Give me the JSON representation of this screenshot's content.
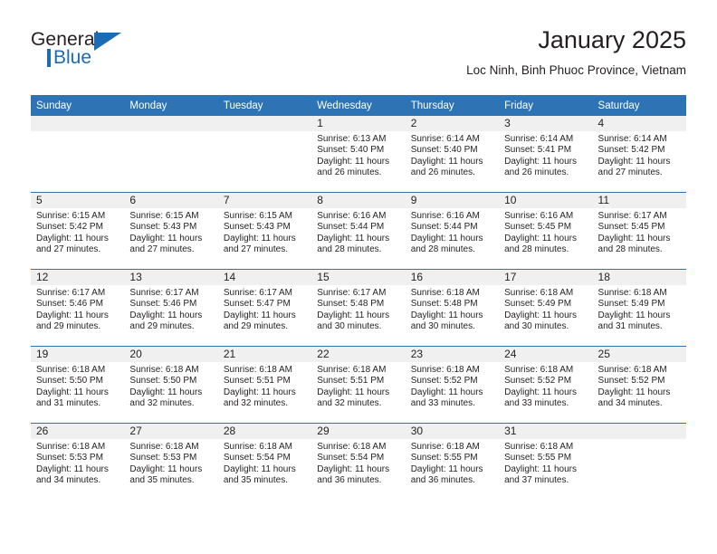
{
  "brand": {
    "name_part1": "General",
    "name_part2": "Blue",
    "logo_icon": "triangle-logo-icon"
  },
  "header": {
    "title": "January 2025",
    "subtitle": "Loc Ninh, Binh Phuoc Province, Vietnam"
  },
  "colors": {
    "header_blue": "#2e74b5",
    "brand_blue": "#1b6bb5",
    "daynum_band": "#f0f0f0",
    "text": "#231f20"
  },
  "calendar": {
    "weekdays": [
      "Sunday",
      "Monday",
      "Tuesday",
      "Wednesday",
      "Thursday",
      "Friday",
      "Saturday"
    ],
    "weeks": [
      [
        {
          "day": "",
          "sunrise": "",
          "sunset": "",
          "daylight_line1": "",
          "daylight_line2": ""
        },
        {
          "day": "",
          "sunrise": "",
          "sunset": "",
          "daylight_line1": "",
          "daylight_line2": ""
        },
        {
          "day": "",
          "sunrise": "",
          "sunset": "",
          "daylight_line1": "",
          "daylight_line2": ""
        },
        {
          "day": "1",
          "sunrise": "Sunrise: 6:13 AM",
          "sunset": "Sunset: 5:40 PM",
          "daylight_line1": "Daylight: 11 hours",
          "daylight_line2": "and 26 minutes."
        },
        {
          "day": "2",
          "sunrise": "Sunrise: 6:14 AM",
          "sunset": "Sunset: 5:40 PM",
          "daylight_line1": "Daylight: 11 hours",
          "daylight_line2": "and 26 minutes."
        },
        {
          "day": "3",
          "sunrise": "Sunrise: 6:14 AM",
          "sunset": "Sunset: 5:41 PM",
          "daylight_line1": "Daylight: 11 hours",
          "daylight_line2": "and 26 minutes."
        },
        {
          "day": "4",
          "sunrise": "Sunrise: 6:14 AM",
          "sunset": "Sunset: 5:42 PM",
          "daylight_line1": "Daylight: 11 hours",
          "daylight_line2": "and 27 minutes."
        }
      ],
      [
        {
          "day": "5",
          "sunrise": "Sunrise: 6:15 AM",
          "sunset": "Sunset: 5:42 PM",
          "daylight_line1": "Daylight: 11 hours",
          "daylight_line2": "and 27 minutes."
        },
        {
          "day": "6",
          "sunrise": "Sunrise: 6:15 AM",
          "sunset": "Sunset: 5:43 PM",
          "daylight_line1": "Daylight: 11 hours",
          "daylight_line2": "and 27 minutes."
        },
        {
          "day": "7",
          "sunrise": "Sunrise: 6:15 AM",
          "sunset": "Sunset: 5:43 PM",
          "daylight_line1": "Daylight: 11 hours",
          "daylight_line2": "and 27 minutes."
        },
        {
          "day": "8",
          "sunrise": "Sunrise: 6:16 AM",
          "sunset": "Sunset: 5:44 PM",
          "daylight_line1": "Daylight: 11 hours",
          "daylight_line2": "and 28 minutes."
        },
        {
          "day": "9",
          "sunrise": "Sunrise: 6:16 AM",
          "sunset": "Sunset: 5:44 PM",
          "daylight_line1": "Daylight: 11 hours",
          "daylight_line2": "and 28 minutes."
        },
        {
          "day": "10",
          "sunrise": "Sunrise: 6:16 AM",
          "sunset": "Sunset: 5:45 PM",
          "daylight_line1": "Daylight: 11 hours",
          "daylight_line2": "and 28 minutes."
        },
        {
          "day": "11",
          "sunrise": "Sunrise: 6:17 AM",
          "sunset": "Sunset: 5:45 PM",
          "daylight_line1": "Daylight: 11 hours",
          "daylight_line2": "and 28 minutes."
        }
      ],
      [
        {
          "day": "12",
          "sunrise": "Sunrise: 6:17 AM",
          "sunset": "Sunset: 5:46 PM",
          "daylight_line1": "Daylight: 11 hours",
          "daylight_line2": "and 29 minutes."
        },
        {
          "day": "13",
          "sunrise": "Sunrise: 6:17 AM",
          "sunset": "Sunset: 5:46 PM",
          "daylight_line1": "Daylight: 11 hours",
          "daylight_line2": "and 29 minutes."
        },
        {
          "day": "14",
          "sunrise": "Sunrise: 6:17 AM",
          "sunset": "Sunset: 5:47 PM",
          "daylight_line1": "Daylight: 11 hours",
          "daylight_line2": "and 29 minutes."
        },
        {
          "day": "15",
          "sunrise": "Sunrise: 6:17 AM",
          "sunset": "Sunset: 5:48 PM",
          "daylight_line1": "Daylight: 11 hours",
          "daylight_line2": "and 30 minutes."
        },
        {
          "day": "16",
          "sunrise": "Sunrise: 6:18 AM",
          "sunset": "Sunset: 5:48 PM",
          "daylight_line1": "Daylight: 11 hours",
          "daylight_line2": "and 30 minutes."
        },
        {
          "day": "17",
          "sunrise": "Sunrise: 6:18 AM",
          "sunset": "Sunset: 5:49 PM",
          "daylight_line1": "Daylight: 11 hours",
          "daylight_line2": "and 30 minutes."
        },
        {
          "day": "18",
          "sunrise": "Sunrise: 6:18 AM",
          "sunset": "Sunset: 5:49 PM",
          "daylight_line1": "Daylight: 11 hours",
          "daylight_line2": "and 31 minutes."
        }
      ],
      [
        {
          "day": "19",
          "sunrise": "Sunrise: 6:18 AM",
          "sunset": "Sunset: 5:50 PM",
          "daylight_line1": "Daylight: 11 hours",
          "daylight_line2": "and 31 minutes."
        },
        {
          "day": "20",
          "sunrise": "Sunrise: 6:18 AM",
          "sunset": "Sunset: 5:50 PM",
          "daylight_line1": "Daylight: 11 hours",
          "daylight_line2": "and 32 minutes."
        },
        {
          "day": "21",
          "sunrise": "Sunrise: 6:18 AM",
          "sunset": "Sunset: 5:51 PM",
          "daylight_line1": "Daylight: 11 hours",
          "daylight_line2": "and 32 minutes."
        },
        {
          "day": "22",
          "sunrise": "Sunrise: 6:18 AM",
          "sunset": "Sunset: 5:51 PM",
          "daylight_line1": "Daylight: 11 hours",
          "daylight_line2": "and 32 minutes."
        },
        {
          "day": "23",
          "sunrise": "Sunrise: 6:18 AM",
          "sunset": "Sunset: 5:52 PM",
          "daylight_line1": "Daylight: 11 hours",
          "daylight_line2": "and 33 minutes."
        },
        {
          "day": "24",
          "sunrise": "Sunrise: 6:18 AM",
          "sunset": "Sunset: 5:52 PM",
          "daylight_line1": "Daylight: 11 hours",
          "daylight_line2": "and 33 minutes."
        },
        {
          "day": "25",
          "sunrise": "Sunrise: 6:18 AM",
          "sunset": "Sunset: 5:52 PM",
          "daylight_line1": "Daylight: 11 hours",
          "daylight_line2": "and 34 minutes."
        }
      ],
      [
        {
          "day": "26",
          "sunrise": "Sunrise: 6:18 AM",
          "sunset": "Sunset: 5:53 PM",
          "daylight_line1": "Daylight: 11 hours",
          "daylight_line2": "and 34 minutes."
        },
        {
          "day": "27",
          "sunrise": "Sunrise: 6:18 AM",
          "sunset": "Sunset: 5:53 PM",
          "daylight_line1": "Daylight: 11 hours",
          "daylight_line2": "and 35 minutes."
        },
        {
          "day": "28",
          "sunrise": "Sunrise: 6:18 AM",
          "sunset": "Sunset: 5:54 PM",
          "daylight_line1": "Daylight: 11 hours",
          "daylight_line2": "and 35 minutes."
        },
        {
          "day": "29",
          "sunrise": "Sunrise: 6:18 AM",
          "sunset": "Sunset: 5:54 PM",
          "daylight_line1": "Daylight: 11 hours",
          "daylight_line2": "and 36 minutes."
        },
        {
          "day": "30",
          "sunrise": "Sunrise: 6:18 AM",
          "sunset": "Sunset: 5:55 PM",
          "daylight_line1": "Daylight: 11 hours",
          "daylight_line2": "and 36 minutes."
        },
        {
          "day": "31",
          "sunrise": "Sunrise: 6:18 AM",
          "sunset": "Sunset: 5:55 PM",
          "daylight_line1": "Daylight: 11 hours",
          "daylight_line2": "and 37 minutes."
        },
        {
          "day": "",
          "sunrise": "",
          "sunset": "",
          "daylight_line1": "",
          "daylight_line2": ""
        }
      ]
    ]
  }
}
